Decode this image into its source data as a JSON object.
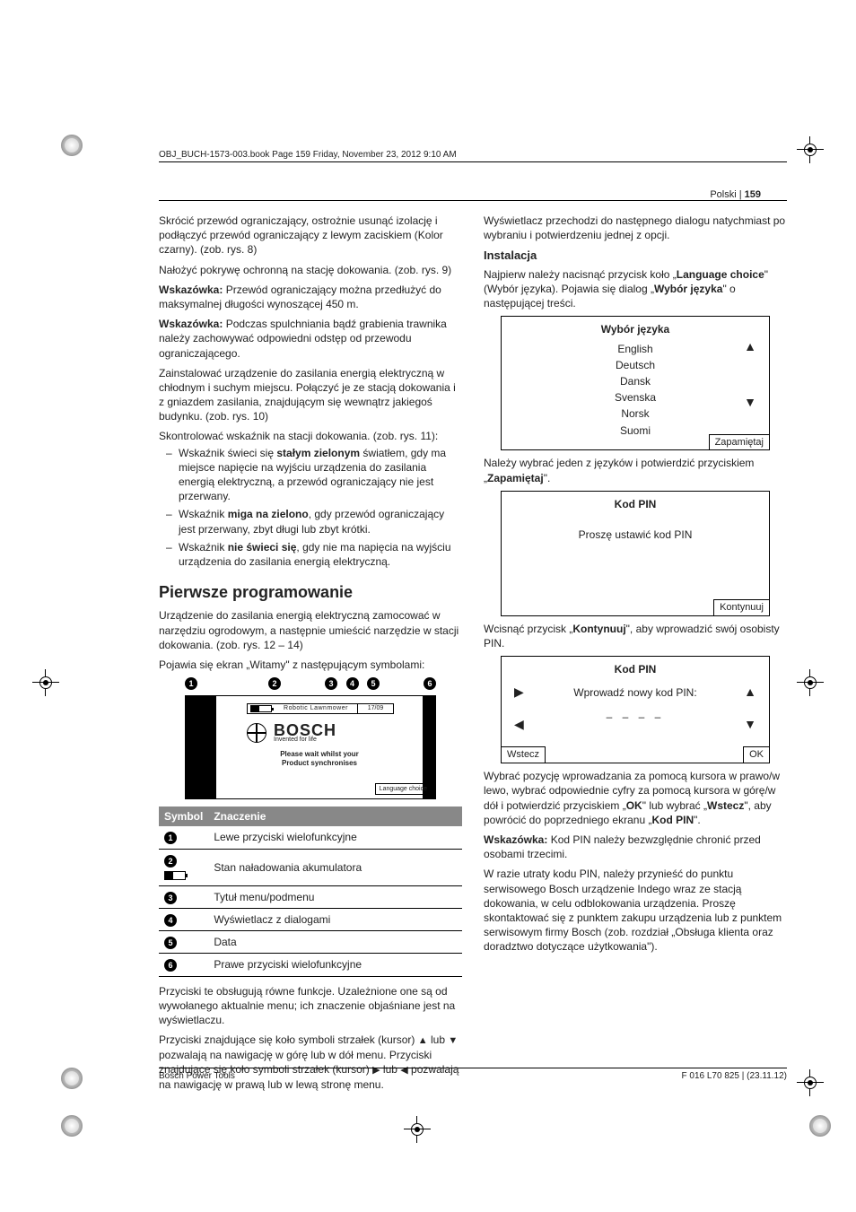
{
  "header_path": "OBJ_BUCH-1573-003.book  Page 159  Friday, November 23, 2012  9:10 AM",
  "page_lang": "Polski",
  "page_sep": " | ",
  "page_num": "159",
  "left": {
    "p1": "Skrócić przewód ograniczający, ostrożnie usunąć izolację i podłączyć przewód ograniczający z lewym zaciskiem (Kolor czarny). (zob. rys. 8)",
    "p2": "Nałożyć pokrywę ochronną na stację dokowania. (zob. rys. 9)",
    "p3a": "Wskazówka:",
    "p3b": " Przewód ograniczający można przedłużyć do maksymalnej długości wynoszącej 450 m.",
    "p4a": "Wskazówka:",
    "p4b": " Podczas spulchniania bądź grabienia trawnika należy zachowywać odpowiedni odstęp od przewodu ograniczającego.",
    "p5": "Zainstalować urządzenie do zasilania energią elektryczną w chłodnym i suchym miejscu. Połączyć je ze stacją dokowania i z gniazdem zasilania, znajdującym się wewnątrz jakiegoś budynku. (zob. rys. 10)",
    "p6": "Skontrolować wskaźnik na stacji dokowania. (zob. rys. 11):",
    "li1a": "Wskaźnik świeci się ",
    "li1b": "stałym zielonym",
    "li1c": " światłem, gdy ma miejsce napięcie na wyjściu urządzenia do zasilania energią elektryczną, a przewód ograniczający nie jest przerwany.",
    "li2a": "Wskaźnik ",
    "li2b": "miga na zielono",
    "li2c": ", gdy przewód ograniczający jest przerwany, zbyt długi lub zbyt krótki.",
    "li3a": "Wskaźnik ",
    "li3b": "nie świeci się",
    "li3c": ", gdy nie ma napięcia na wyjściu urządzenia do zasilania energią elektryczną.",
    "h1": "Pierwsze programowanie",
    "p7": "Urządzenie do zasilania energią elektryczną zamocować w narzędziu ogrodowym, a następnie umieścić narzędzie w stacji dokowania. (zob. rys. 12 – 14)",
    "p8": "Pojawia się ekran „Witamy\" z następującym symbolami:",
    "welcome": {
      "strip_label": "Robotic Lawnmower",
      "strip_date": "17/09",
      "brand": "BOSCH",
      "tag": "Invented for life",
      "wait": "Please wait whilst your",
      "sync": "Product synchronises",
      "lang": "Language choice"
    },
    "table": {
      "h1": "Symbol",
      "h2": "Znaczenie",
      "r1": "Lewe przyciski wielofunkcyjne",
      "r2": "Stan naładowania akumulatora",
      "r3": "Tytuł menu/podmenu",
      "r4": "Wyświetlacz z dialogami",
      "r5": "Data",
      "r6": "Prawe przyciski wielofunkcyjne"
    },
    "p9": "Przyciski te obsługują równe funkcje. Uzależnione one są od wywołanego aktualnie menu; ich znaczenie objaśniane jest na wyświetlaczu.",
    "p10a": "Przyciski znajdujące się koło symboli strzałek (kursor) ",
    "p10b": " lub ",
    "p10c": " pozwalają na nawigację w górę lub w dół menu. Przyciski znajdujące się koło symboli strzałek (kursor) ",
    "p10d": " lub ",
    "p10e": " pozwalają na nawigację w prawą lub w lewą stronę menu."
  },
  "right": {
    "p1": "Wyświetlacz przechodzi do następnego dialogu natychmiast po wybraniu i potwierdzeniu jednej z opcji.",
    "h2": "Instalacja",
    "p2a": "Najpierw należy nacisnąć przycisk koło „",
    "p2b": "Language choice",
    "p2c": "\" (Wybór języka). Pojawia się dialog „",
    "p2d": "Wybór języka",
    "p2e": "\" o następującej treści.",
    "screen1": {
      "title": "Wybór języka",
      "items": [
        "English",
        "Deutsch",
        "Dansk",
        "Svenska",
        "Norsk",
        "Suomi"
      ],
      "btn": "Zapamiętaj"
    },
    "p3a": "Należy wybrać jeden z języków i potwierdzić przyciskiem „",
    "p3b": "Zapamiętaj",
    "p3c": "\".",
    "screen2": {
      "title": "Kod PIN",
      "msg": "Proszę ustawić kod PIN",
      "btn": "Kontynuuj"
    },
    "p4a": "Wcisnąć przycisk „",
    "p4b": "Kontynuuj",
    "p4c": "\", aby wprowadzić swój osobisty PIN.",
    "screen3": {
      "title": "Kod PIN",
      "msg": "Wprowadź nowy kod PIN:",
      "dashes": "– – – –",
      "btn_l": "Wstecz",
      "btn_r": "OK"
    },
    "p5a": "Wybrać pozycję wprowadzania za pomocą kursora w prawo/w lewo, wybrać odpowiednie cyfry za pomocą kursora w górę/w dół i potwierdzić przyciskiem „",
    "p5b": "OK",
    "p5c": "\" lub wybrać „",
    "p5d": "Wstecz",
    "p5e": "\", aby powrócić do poprzedniego ekranu „",
    "p5f": "Kod PIN",
    "p5g": "\".",
    "p6a": "Wskazówka:",
    "p6b": " Kod PIN należy bezwzględnie chronić przed osobami trzecimi.",
    "p7": "W razie utraty kodu PIN, należy przynieść do punktu serwisowego Bosch urządzenie Indego wraz ze stacją dokowania, w celu odblokowania urządzenia. Proszę skontaktować się z punktem zakupu urządzenia lub z punktem serwisowym firmy Bosch (zob. rozdział „Obsługa klienta oraz doradztwo dotyczące użytkowania\")."
  },
  "footer": {
    "left": "Bosch Power Tools",
    "right": "F 016 L70 825 | (23.11.12)"
  }
}
